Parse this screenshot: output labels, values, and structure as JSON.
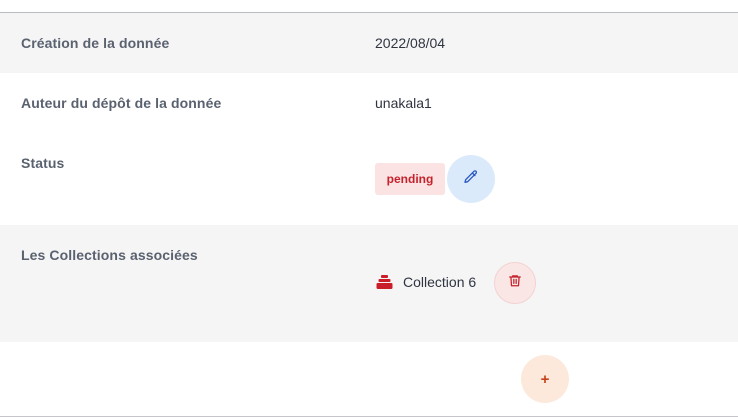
{
  "fields": {
    "creation": {
      "label": "Création de la donnée",
      "value": "2022/08/04"
    },
    "auteur": {
      "label": "Auteur du dépôt de la donnée",
      "value": "unakala1"
    },
    "status": {
      "label": "Status",
      "badge": "pending",
      "edit_icon": "pencil-icon"
    },
    "collections": {
      "label": "Les Collections associées",
      "items": [
        {
          "name": "Collection 6",
          "icon": "collection-stack-icon",
          "delete_icon": "trash-icon"
        }
      ]
    }
  },
  "add_button": {
    "label": "+"
  },
  "colors": {
    "row_shade": "#f5f5f5",
    "badge_bg": "#fbe3e3",
    "badge_text": "#c4222c",
    "edit_bg": "#dbeafb",
    "edit_icon": "#2b59c3",
    "delete_bg": "#fbe6e6",
    "delete_icon": "#c4222c",
    "add_bg": "#fde9db",
    "add_text": "#c6421c",
    "collection_icon": "#c91d2a"
  }
}
